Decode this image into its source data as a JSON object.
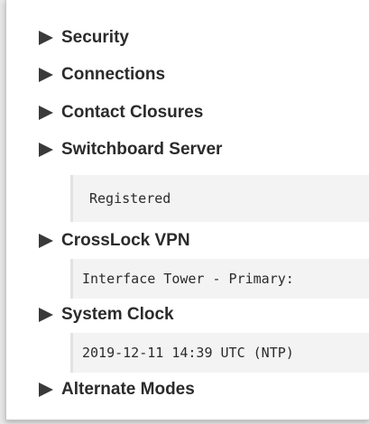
{
  "sections": [
    {
      "label": "Security"
    },
    {
      "label": "Connections"
    },
    {
      "label": "Contact Closures"
    },
    {
      "label": "Switchboard Server",
      "detail": "Registered"
    },
    {
      "label": "CrossLock VPN",
      "detail": "Interface Tower - Primary:"
    },
    {
      "label": "System Clock",
      "detail": "2019-12-11 14:39 UTC (NTP)"
    },
    {
      "label": "Alternate Modes"
    }
  ],
  "icons": {
    "expander": "right-triangle-icon"
  }
}
